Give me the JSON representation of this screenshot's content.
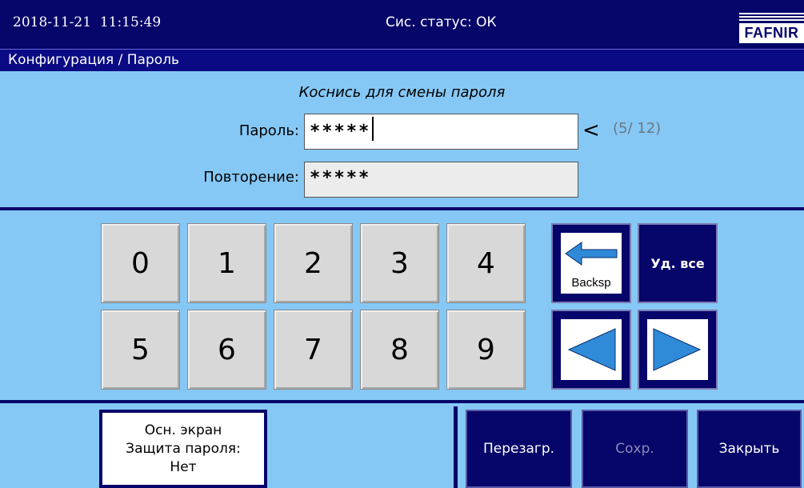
{
  "topbar": {
    "datetime": "2018-11-21  11:15:49",
    "status": "Сис. статус: ОК",
    "logo_text": "FAFNIR"
  },
  "breadcrumb": "Конфигурация / Пароль",
  "hint": "Коснись для смены пароля",
  "password": {
    "label": "Пароль:",
    "value": "*****",
    "indicator": "<",
    "counter": "(5/ 12)"
  },
  "repeat": {
    "label": "Повторение:",
    "value": "*****"
  },
  "keypad": {
    "keys": [
      "0",
      "1",
      "2",
      "3",
      "4",
      "5",
      "6",
      "7",
      "8",
      "9"
    ]
  },
  "nav": {
    "backspace_label": "Backsp",
    "delete_all_label": "Уд. все",
    "left_icon": "left-arrow-icon",
    "right_icon": "right-arrow-icon"
  },
  "info": {
    "line1": "Осн. экран",
    "line2": "Защита пароля:",
    "line3": "Нет"
  },
  "footer": {
    "reboot": "Перезагр.",
    "save": "Сохр.",
    "close": "Закрыть"
  },
  "colors": {
    "background": "#86c8f5",
    "bar": "#05056a",
    "arrow": "#2f8bd8"
  }
}
